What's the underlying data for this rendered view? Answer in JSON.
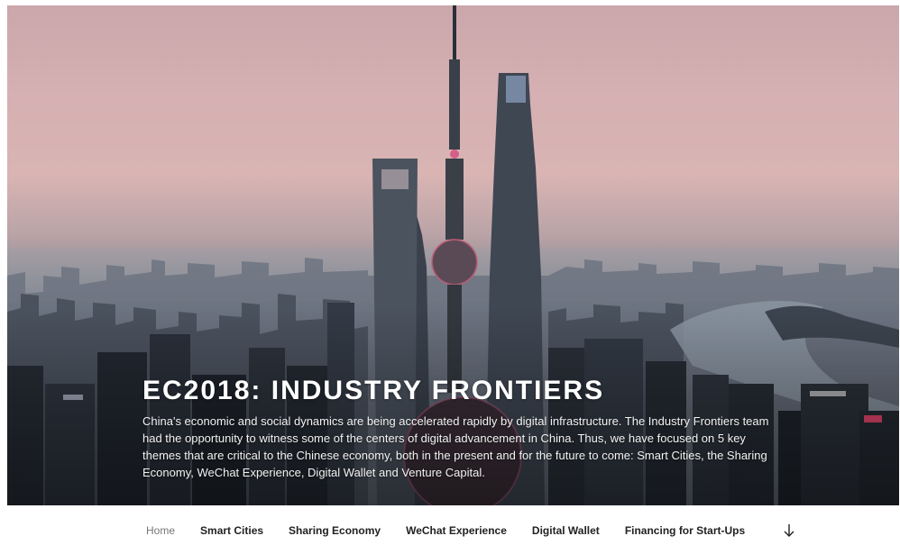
{
  "header": {
    "site_title": "EC2018: INDUSTRY FRONTIERS",
    "site_description": "China's economic and social dynamics are being accelerated rapidly by digital infrastructure. The Industry Frontiers team had the opportunity to witness some of the centers of digital advancement in China. Thus, we have focused on 5 key themes that are critical to the Chinese economy, both in the present and for the future to come: Smart Cities, the Sharing Economy, WeChat Experience, Digital Wallet and Venture Capital."
  },
  "nav": {
    "items": [
      {
        "label": "Home",
        "current": true
      },
      {
        "label": "Smart Cities"
      },
      {
        "label": "Sharing Economy"
      },
      {
        "label": "WeChat Experience"
      },
      {
        "label": "Digital Wallet"
      },
      {
        "label": "Financing for Start-Ups"
      }
    ],
    "scroll_icon": "arrow-down-icon"
  },
  "colors": {
    "nav_text": "#222222",
    "nav_current": "#767676",
    "title": "#ffffff"
  }
}
